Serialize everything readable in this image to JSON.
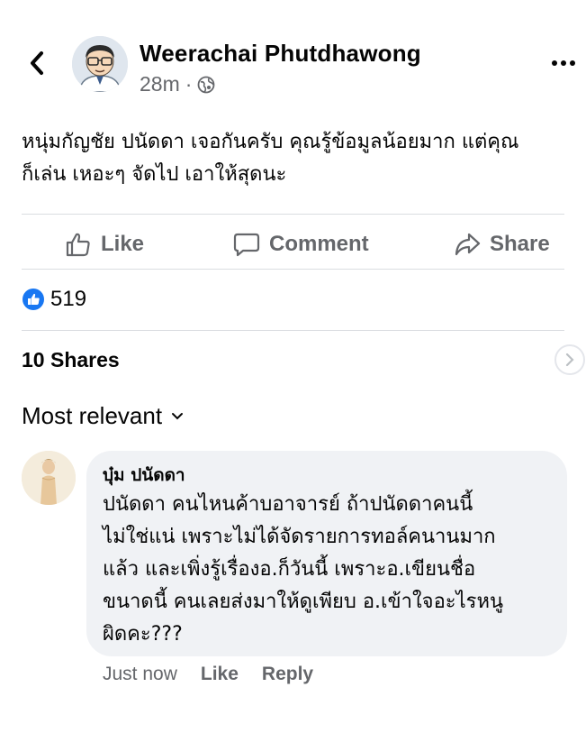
{
  "post": {
    "author": "Weerachai Phutdhawong",
    "time": "28m",
    "separator": "·",
    "privacy_icon": "globe-icon",
    "text_lines": [
      "หนุ่มกัญชัย ปนัดดา เจอกันครับ คุณรู้ข้อมูลน้อยมาก แต่คุณ",
      "ก็เล่น เหอะๆ จัดไป เอาให้สุดนะ"
    ]
  },
  "actions": {
    "like": "Like",
    "comment": "Comment",
    "share": "Share"
  },
  "stats": {
    "reactions_count": "519",
    "shares": "10 Shares"
  },
  "comments_section": {
    "sort_label": "Most relevant"
  },
  "comment": {
    "author": "บุ๋ม ปนัดดา",
    "text_lines": [
      "ปนัดดา คนไหนค้าบอาจารย์ ถ้าปนัดดาคนนี้",
      "ไม่ใช่แน่ เพราะไม่ได้จัดรายการทอล์คนานมาก",
      "แล้ว และเพิ่งรู้เรื่องอ.ก็วันนี้ เพราะอ.เขียนชื่อ",
      "ขนาดนี้ คนเลยส่งมาให้ดูเพียบ อ.เข้าใจอะไรหนู",
      "ผิดคะ???"
    ],
    "time": "Just now",
    "like": "Like",
    "reply": "Reply"
  },
  "colors": {
    "text": "#050505",
    "secondary": "#65676b",
    "like_blue": "#1877f2",
    "bubble": "#f0f2f5",
    "divider": "#dadde1"
  }
}
